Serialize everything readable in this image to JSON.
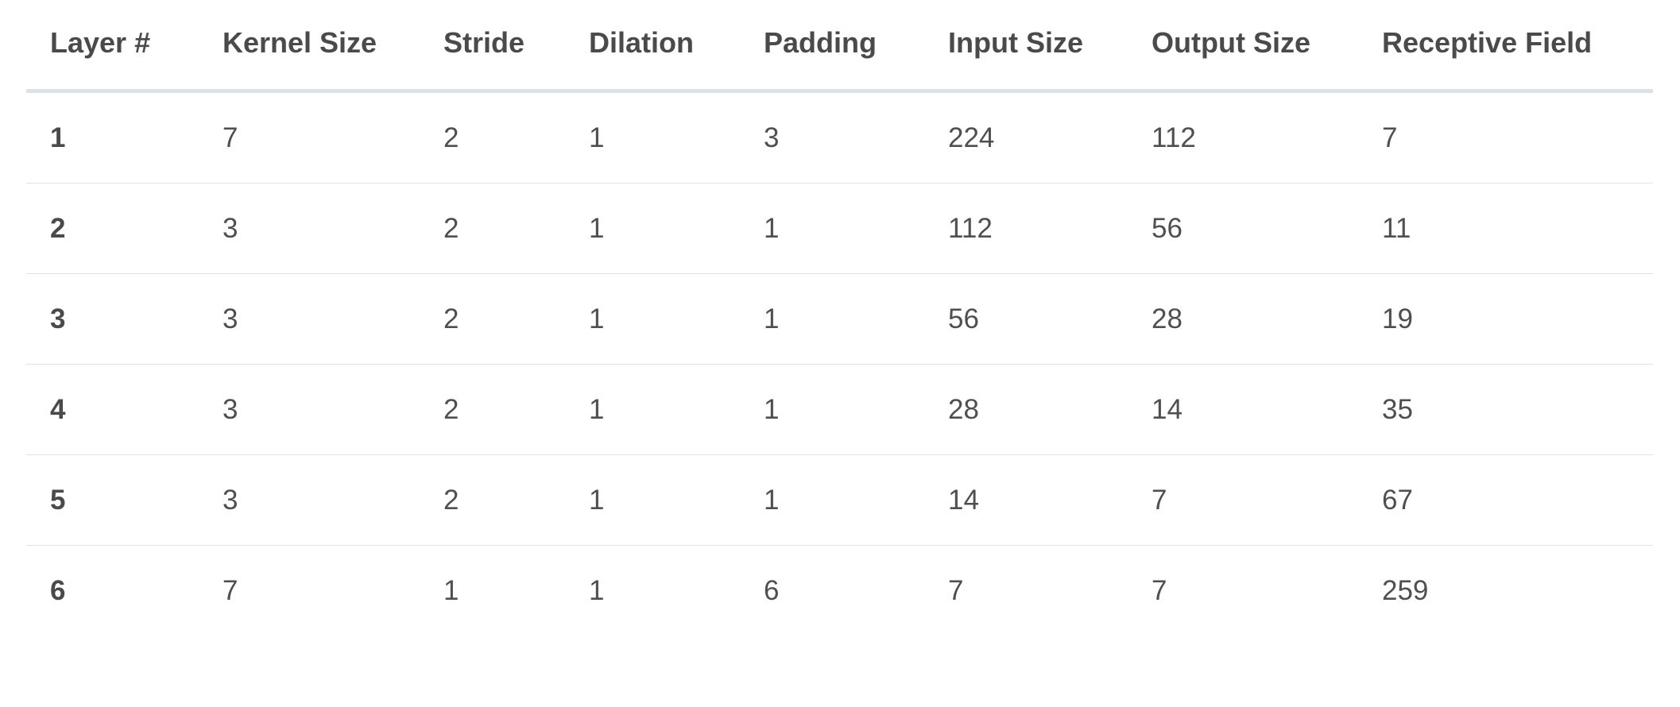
{
  "table": {
    "columns": [
      "Layer #",
      "Kernel Size",
      "Stride",
      "Dilation",
      "Padding",
      "Input Size",
      "Output Size",
      "Receptive Field"
    ],
    "rows": [
      [
        "1",
        "7",
        "2",
        "1",
        "3",
        "224",
        "112",
        "7"
      ],
      [
        "2",
        "3",
        "2",
        "1",
        "1",
        "112",
        "56",
        "11"
      ],
      [
        "3",
        "3",
        "2",
        "1",
        "1",
        "56",
        "28",
        "19"
      ],
      [
        "4",
        "3",
        "2",
        "1",
        "1",
        "28",
        "14",
        "35"
      ],
      [
        "5",
        "3",
        "2",
        "1",
        "1",
        "14",
        "7",
        "67"
      ],
      [
        "6",
        "7",
        "1",
        "1",
        "6",
        "7",
        "7",
        "259"
      ]
    ]
  },
  "colors": {
    "text": "#4a4a4a",
    "header_rule": "#dce3e8",
    "row_rule": "#e2e2e2",
    "background": "#ffffff"
  }
}
